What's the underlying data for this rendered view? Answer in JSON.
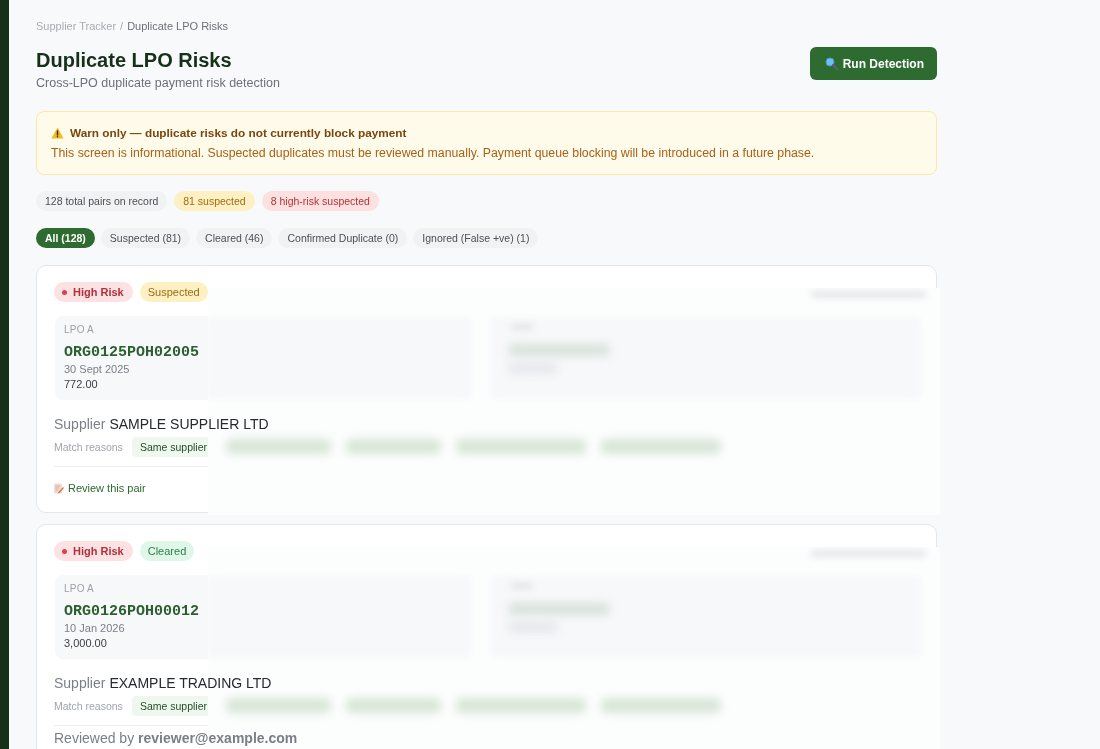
{
  "breadcrumb": {
    "items": [
      {
        "label": "Supplier Tracker",
        "current": false
      },
      {
        "label": "Duplicate LPO Risks",
        "current": true
      }
    ],
    "separator": "/"
  },
  "header": {
    "title": "Duplicate LPO Risks",
    "subtitle": "Cross-LPO duplicate payment risk detection",
    "action": "Run Detection"
  },
  "notice": {
    "title": "Warn only — duplicate risks do not currently block payment",
    "body": "This screen is informational. Suspected duplicates must be reviewed manually. Payment queue blocking will be introduced in a future phase."
  },
  "summary": [
    {
      "label": "128 total pairs on record",
      "kind": "neutral"
    },
    {
      "label": "81 suspected",
      "kind": "warning"
    },
    {
      "label": "8 high-risk suspected",
      "kind": "danger"
    }
  ],
  "filter_tabs": [
    {
      "label": "All (128)",
      "selected": true
    },
    {
      "label": "Suspected (81)",
      "selected": false
    },
    {
      "label": "Cleared (46)",
      "selected": false
    },
    {
      "label": "Confirmed Duplicate (0)",
      "selected": false
    },
    {
      "label": "Ignored (False +ve) (1)",
      "selected": false
    }
  ],
  "pairs": [
    {
      "risk": {
        "label": "High Risk",
        "kind": "high"
      },
      "status": {
        "label": "Suspected",
        "kind": "suspected"
      },
      "lpo_a": {
        "heading": "LPO A",
        "number": "ORG0125POH02005",
        "date": "30 Sept 2025",
        "amount": "772.00"
      },
      "supplier_label": "Supplier",
      "supplier": "SAMPLE SUPPLIER LTD",
      "match_label": "Match reasons",
      "match_reasons": [
        "Same supplier"
      ],
      "footer": {
        "kind": "action",
        "text": "Review this pair"
      }
    },
    {
      "risk": {
        "label": "High Risk",
        "kind": "high"
      },
      "status": {
        "label": "Cleared",
        "kind": "cleared"
      },
      "lpo_a": {
        "heading": "LPO A",
        "number": "ORG0126POH00012",
        "date": "10 Jan 2026",
        "amount": "3,000.00"
      },
      "supplier_label": "Supplier",
      "supplier": "EXAMPLE TRADING LTD",
      "match_label": "Match reasons",
      "match_reasons": [
        "Same supplier"
      ],
      "footer": {
        "kind": "reviewed",
        "text": "Reviewed by **reviewer@example.com**"
      }
    }
  ]
}
